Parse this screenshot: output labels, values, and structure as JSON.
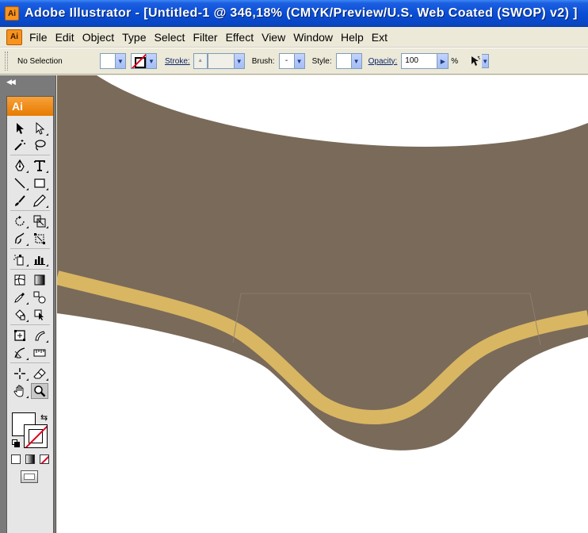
{
  "window": {
    "title": "Adobe Illustrator - [Untitled-1 @ 346,18% (CMYK/Preview/U.S. Web Coated (SWOP) v2) ]",
    "app_icon": "Ai"
  },
  "menu": {
    "logo": "Ai",
    "items": [
      "File",
      "Edit",
      "Object",
      "Type",
      "Select",
      "Filter",
      "Effect",
      "View",
      "Window",
      "Help",
      "Ext"
    ]
  },
  "control_bar": {
    "selection": "No Selection",
    "stroke_label": "Stroke:",
    "brush_label": "Brush:",
    "brush_value": "-",
    "style_label": "Style:",
    "opacity_label": "Opacity:",
    "opacity_value": "100",
    "opacity_unit": "%"
  },
  "toolbox": {
    "badge": "Ai",
    "active_tool": "zoom-tool"
  },
  "colors": {
    "shape_brown": "#7a6a5a",
    "stripe_gold": "#d9b662",
    "canvas": "#ffffff",
    "toolbox_bg": "#7a7a7a",
    "titlebar_blue": "#0a4ed6"
  }
}
